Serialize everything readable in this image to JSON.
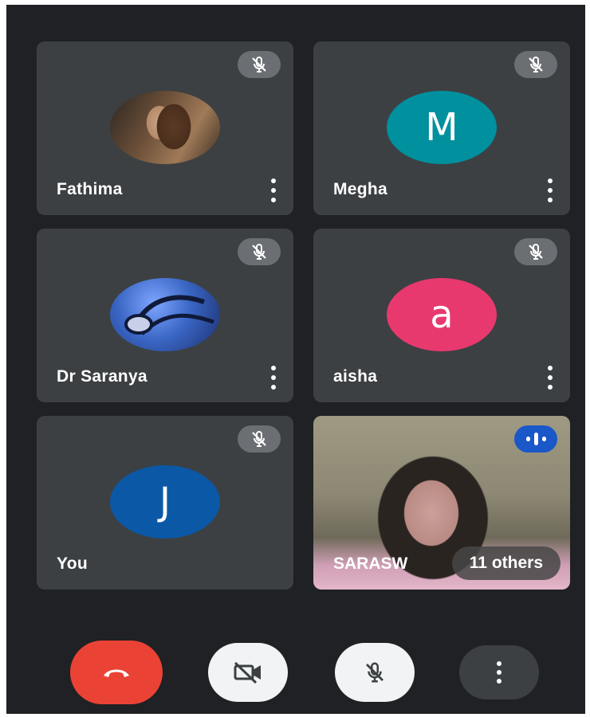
{
  "participants": [
    {
      "name": "Fathima",
      "avatar_letter": "",
      "avatar_color": "#7a5a3a",
      "muted": true
    },
    {
      "name": "Megha",
      "avatar_letter": "M",
      "avatar_color": "#00909e",
      "muted": true
    },
    {
      "name": "Dr Saranya",
      "avatar_letter": "",
      "avatar_color": "#3a66c4",
      "muted": true
    },
    {
      "name": "aisha",
      "avatar_letter": "a",
      "avatar_color": "#e8396f",
      "muted": true
    },
    {
      "name": "You",
      "avatar_letter": "J",
      "avatar_color": "#0b58a7",
      "muted": true
    }
  ],
  "video_tile": {
    "name": "SARASW",
    "others_label": "11 others",
    "speaking": true
  },
  "controls": {
    "end_call_color": "#ea4335",
    "end_call_icon": "phone-hangup-icon",
    "camera_icon": "camera-off-icon",
    "mic_icon": "mic-off-icon",
    "more_icon": "more-vert-icon"
  },
  "colors": {
    "background": "#202124",
    "tile": "#3c4043",
    "speaking_badge": "#1a57c8"
  }
}
